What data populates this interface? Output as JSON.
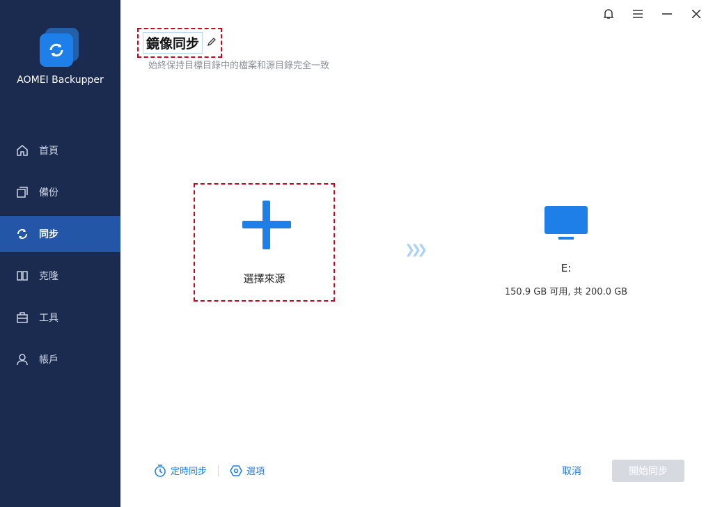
{
  "app": {
    "name": "AOMEI Backupper"
  },
  "sidebar": {
    "items": [
      {
        "label": "首頁",
        "icon": "home-icon",
        "active": false
      },
      {
        "label": "備份",
        "icon": "backup-icon",
        "active": false
      },
      {
        "label": "同步",
        "icon": "sync-icon",
        "active": true
      },
      {
        "label": "克隆",
        "icon": "clone-icon",
        "active": false
      },
      {
        "label": "工具",
        "icon": "tools-icon",
        "active": false
      },
      {
        "label": "帳戶",
        "icon": "account-icon",
        "active": false
      }
    ]
  },
  "header": {
    "title": "鏡像同步",
    "subtitle": "始終保持目標目錄中的檔案和源目錄完全一致"
  },
  "source": {
    "label": "選擇來源"
  },
  "destination": {
    "name": "E:",
    "space": "150.9 GB 可用, 共 200.0 GB"
  },
  "footer": {
    "schedule_label": "定時同步",
    "options_label": "選項",
    "cancel_label": "取消",
    "start_label": "開始同步"
  },
  "colors": {
    "sidebar_bg": "#1b2b4f",
    "active_nav": "#2456a8",
    "accent": "#1f7fe8",
    "highlight_border": "#d0021b"
  }
}
